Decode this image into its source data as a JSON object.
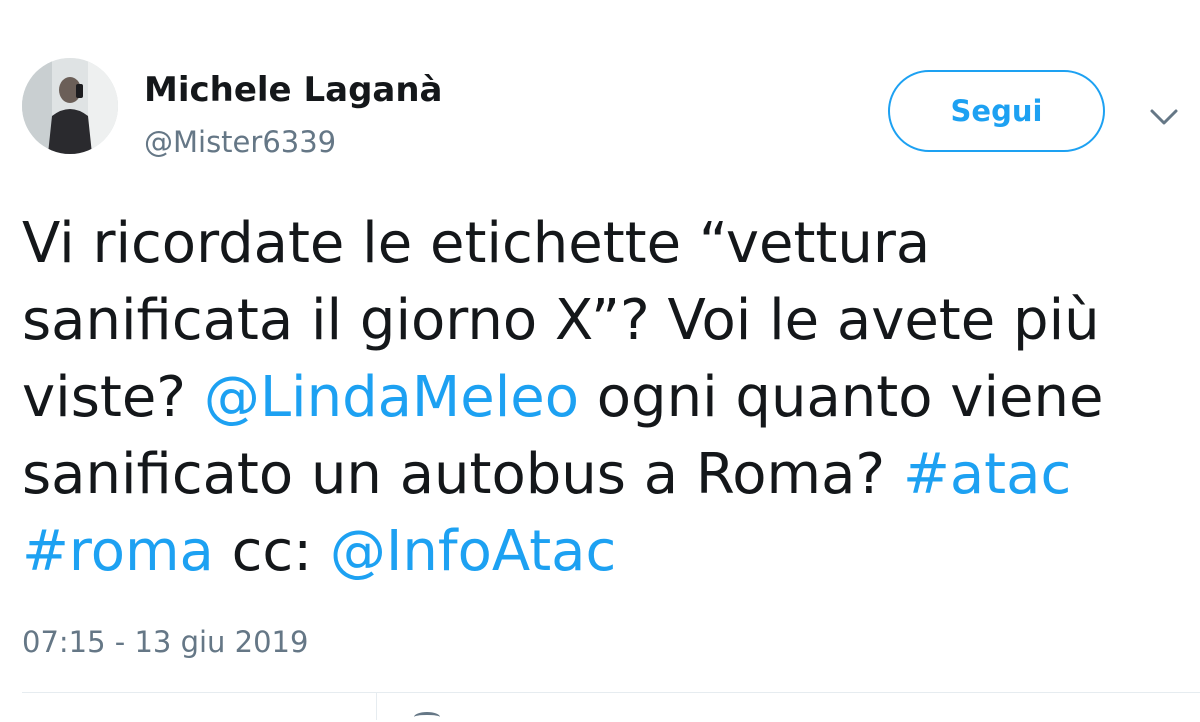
{
  "user": {
    "name": "Michele Laganà",
    "handle": "@Mister6339",
    "avatar_icon": "profile-photo"
  },
  "follow_button": {
    "label": "Segui"
  },
  "menu_icon": "chevron-down-icon",
  "tweet": {
    "segments": [
      {
        "text": "Vi ricordate le etichette “vettura sanificata il giorno X”? Voi le avete più viste? ",
        "type": "text"
      },
      {
        "text": "@LindaMeleo",
        "type": "mention"
      },
      {
        "text": " ogni quanto viene sanificato un autobus a Roma? ",
        "type": "text"
      },
      {
        "text": "#atac",
        "type": "hashtag"
      },
      {
        "text": " ",
        "type": "text"
      },
      {
        "text": "#roma",
        "type": "hashtag"
      },
      {
        "text": " cc: ",
        "type": "text"
      },
      {
        "text": "@InfoAtac",
        "type": "mention"
      }
    ]
  },
  "timestamp": "07:15 - 13 giu 2019",
  "colors": {
    "link": "#1da1f2",
    "text": "#14171a",
    "secondary": "#657786"
  }
}
